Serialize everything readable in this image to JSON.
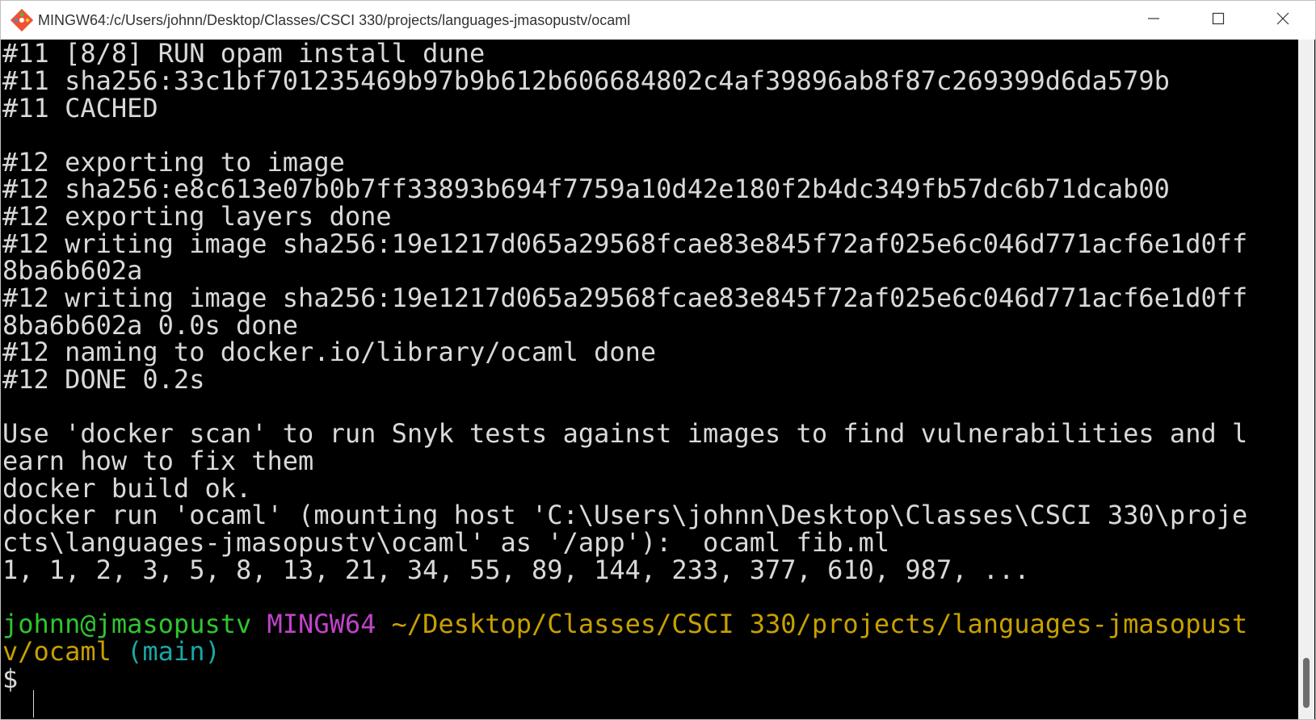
{
  "window": {
    "title": "MINGW64:/c/Users/johnn/Desktop/Classes/CSCI 330/projects/languages-jmasopustv/ocaml",
    "app_icon": "git-bash-icon",
    "controls": [
      "minimize-icon",
      "maximize-icon",
      "close-icon"
    ]
  },
  "terminal": {
    "lines": [
      "#11 [8/8] RUN opam install dune",
      "#11 sha256:33c1bf701235469b97b9b612b606684802c4af39896ab8f87c269399d6da579b",
      "#11 CACHED",
      "",
      "#12 exporting to image",
      "#12 sha256:e8c613e07b0b7ff33893b694f7759a10d42e180f2b4dc349fb57dc6b71dcab00",
      "#12 exporting layers done",
      "#12 writing image sha256:19e1217d065a29568fcae83e845f72af025e6c046d771acf6e1d0ff",
      "8ba6b602a",
      "#12 writing image sha256:19e1217d065a29568fcae83e845f72af025e6c046d771acf6e1d0ff",
      "8ba6b602a 0.0s done",
      "#12 naming to docker.io/library/ocaml done",
      "#12 DONE 0.2s",
      "",
      "Use 'docker scan' to run Snyk tests against images to find vulnerabilities and l",
      "earn how to fix them",
      "docker build ok.",
      "docker run 'ocaml' (mounting host 'C:\\Users\\johnn\\Desktop\\Classes\\CSCI 330\\proje",
      "cts\\languages-jmasopustv\\ocaml' as '/app'):  ocaml fib.ml",
      "1, 1, 2, 3, 5, 8, 13, 21, 34, 55, 89, 144, 233, 377, 610, 987, ..."
    ],
    "prompt": {
      "user_host": "johnn@jmasopustv",
      "system": "MINGW64",
      "path_part1": "~/Desktop/Classes/CSCI 330/projects/languages-jmasopust",
      "path_part2": "v/ocaml",
      "branch": "(main)",
      "symbol": "$"
    }
  },
  "colors": {
    "text": "#d9d9d9",
    "user_host": "#2fc52f",
    "system": "#c044c8",
    "path": "#c8a000",
    "branch": "#1aa7a7",
    "background": "#000000"
  }
}
